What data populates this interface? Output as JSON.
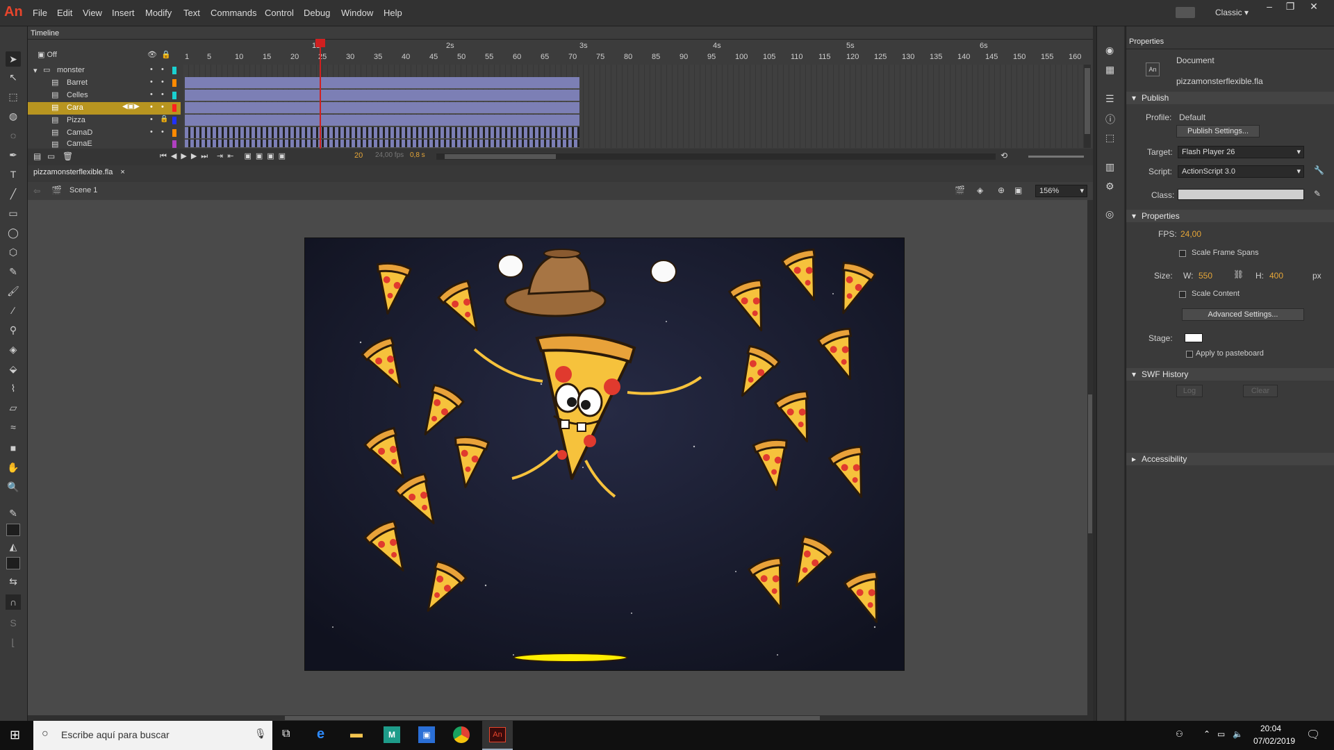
{
  "app": {
    "logo": "An"
  },
  "menu": [
    "File",
    "Edit",
    "View",
    "Insert",
    "Modify",
    "Text",
    "Commands",
    "Control",
    "Debug",
    "Window",
    "Help"
  ],
  "workspace": "Classic",
  "timeline": {
    "tab": "Timeline",
    "onion_label": "Off",
    "layers": [
      {
        "name": "monster",
        "type": "folder",
        "color": "#1ad0d0"
      },
      {
        "name": "Barret",
        "type": "layer",
        "color": "#ff8a00"
      },
      {
        "name": "Celles",
        "type": "layer",
        "color": "#1ad0d0"
      },
      {
        "name": "Cara",
        "type": "layer",
        "color": "#ff2020",
        "selected": true
      },
      {
        "name": "Pizza",
        "type": "layer",
        "color": "#2030ff",
        "locked": true
      },
      {
        "name": "CamaD",
        "type": "layer",
        "color": "#ff8a00"
      },
      {
        "name": "CamaE",
        "type": "layer",
        "color": "#b040c0"
      }
    ],
    "ruler_numbers": [
      "1",
      "5",
      "10",
      "15",
      "20",
      "25",
      "30",
      "35",
      "40",
      "45",
      "50",
      "55",
      "60",
      "65",
      "70",
      "75",
      "80",
      "85",
      "90",
      "95",
      "100",
      "105",
      "110",
      "115",
      "120",
      "125",
      "130",
      "135",
      "140",
      "145",
      "150",
      "155",
      "160"
    ],
    "seconds": [
      "1s",
      "2s",
      "3s",
      "4s",
      "5s",
      "6s"
    ],
    "current_frame": "20",
    "fps_readout": "24,00 fps",
    "time_readout": "0,8 s"
  },
  "document": {
    "tab": "pizzamonsterflexible.fla",
    "scene": "Scene 1",
    "zoom": "156%"
  },
  "properties": {
    "tab": "Properties",
    "doc_type": "Document",
    "doc_name": "pizzamonsterflexible.fla",
    "publish_header": "Publish",
    "profile_label": "Profile:",
    "profile_value": "Default",
    "publish_settings": "Publish Settings...",
    "target_label": "Target:",
    "target_value": "Flash Player 26",
    "script_label": "Script:",
    "script_value": "ActionScript 3.0",
    "class_label": "Class:",
    "properties_header": "Properties",
    "fps_label": "FPS:",
    "fps_value": "24,00",
    "scale_frame_spans": "Scale Frame Spans",
    "size_label": "Size:",
    "w_label": "W:",
    "w_value": "550",
    "h_label": "H:",
    "h_value": "400",
    "px": "px",
    "scale_content": "Scale Content",
    "advanced_settings": "Advanced Settings...",
    "stage_label": "Stage:",
    "apply_pasteboard": "Apply to pasteboard",
    "swf_history": "SWF History",
    "log": "Log",
    "clear": "Clear",
    "accessibility": "Accessibility"
  },
  "taskbar": {
    "search_placeholder": "Escribe aquí para buscar",
    "time": "20:04",
    "date": "07/02/2019"
  },
  "colors": {
    "accent": "#b89520",
    "frame_fill": "#7c7fb5",
    "stage_bg": "#14162a"
  }
}
